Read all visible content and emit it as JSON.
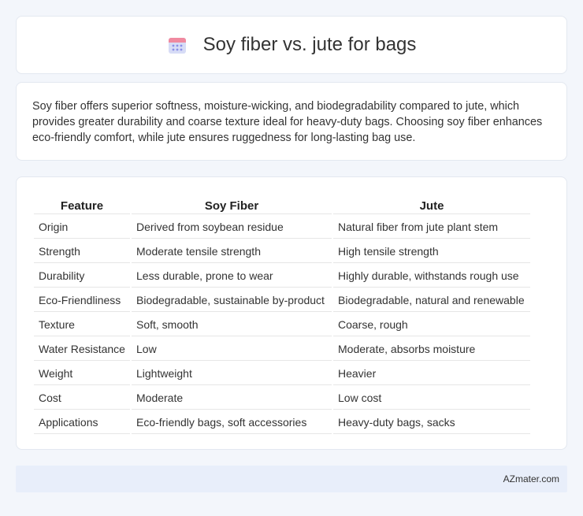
{
  "header": {
    "title": "Soy fiber vs. jute for bags",
    "icon": "calendar-icon",
    "icon_colors": {
      "top": "#f08aa0",
      "body": "#d7dcf6",
      "dots": "#8b8fe8"
    }
  },
  "summary": {
    "text": "Soy fiber offers superior softness, moisture-wicking, and biodegradability compared to jute, which provides greater durability and coarse texture ideal for heavy-duty bags. Choosing soy fiber enhances eco-friendly comfort, while jute ensures ruggedness for long-lasting bag use."
  },
  "table": {
    "headers": [
      "Feature",
      "Soy Fiber",
      "Jute"
    ],
    "rows": [
      [
        "Origin",
        "Derived from soybean residue",
        "Natural fiber from jute plant stem"
      ],
      [
        "Strength",
        "Moderate tensile strength",
        "High tensile strength"
      ],
      [
        "Durability",
        "Less durable, prone to wear",
        "Highly durable, withstands rough use"
      ],
      [
        "Eco-Friendliness",
        "Biodegradable, sustainable by-product",
        "Biodegradable, natural and renewable"
      ],
      [
        "Texture",
        "Soft, smooth",
        "Coarse, rough"
      ],
      [
        "Water Resistance",
        "Low",
        "Moderate, absorbs moisture"
      ],
      [
        "Weight",
        "Lightweight",
        "Heavier"
      ],
      [
        "Cost",
        "Moderate",
        "Low cost"
      ],
      [
        "Applications",
        "Eco-friendly bags, soft accessories",
        "Heavy-duty bags, sacks"
      ]
    ]
  },
  "footer": {
    "brand": "AZmater.com"
  }
}
